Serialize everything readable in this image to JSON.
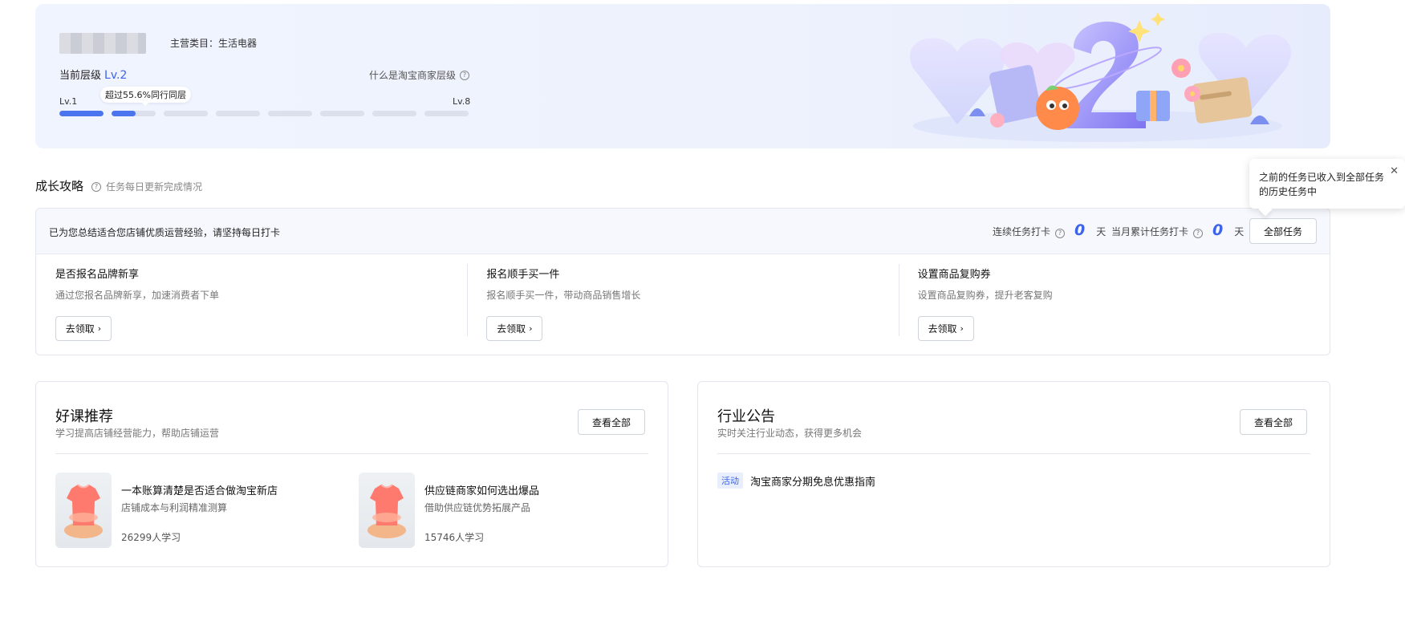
{
  "banner": {
    "main_category": "主营类目：生活电器",
    "level_label": "当前层级",
    "level_value": "Lv.2",
    "what_link": "什么是淘宝商家层级",
    "lv_min": "Lv.1",
    "lv_max": "Lv.8",
    "progress_tip": "超过55.6%同行同层",
    "levels_total": 8,
    "current_level": 2,
    "current_segment_fill": 0.55
  },
  "growth": {
    "title": "成长攻略",
    "subtitle": "任务每日更新完成情况",
    "hint": "已为您总结适合您店铺优质运营经验，请坚持每日打卡",
    "streak_label": "连续任务打卡",
    "streak_value": "0",
    "month_label": "当月累计任务打卡",
    "month_value": "0",
    "unit": "天",
    "all_tasks_btn": "全部任务",
    "tasks": [
      {
        "title": "是否报名品牌新享",
        "desc": "通过您报名品牌新享，加速消费者下单",
        "btn": "去领取"
      },
      {
        "title": "报名顺手买一件",
        "desc": "报名顺手买一件，带动商品销售增长",
        "btn": "去领取"
      },
      {
        "title": "设置商品复购券",
        "desc": "设置商品复购券，提升老客复购",
        "btn": "去领取"
      }
    ]
  },
  "popover": {
    "text": "之前的任务已收入到全部任务的历史任务中",
    "close": "✕"
  },
  "courses": {
    "title": "好课推荐",
    "subtitle": "学习提高店铺经营能力，帮助店铺运营",
    "view_all": "查看全部",
    "items": [
      {
        "title": "一本账算清楚是否适合做淘宝新店",
        "desc": "店铺成本与利润精准测算",
        "count": "26299人学习"
      },
      {
        "title": "供应链商家如何选出爆品",
        "desc": "借助供应链优势拓展产品",
        "count": "15746人学习"
      }
    ]
  },
  "notice": {
    "title": "行业公告",
    "subtitle": "实时关注行业动态，获得更多机会",
    "view_all": "查看全部",
    "items": [
      {
        "tag": "活动",
        "text": "淘宝商家分期免息优惠指南"
      }
    ]
  },
  "icons": {
    "help": "?",
    "chevron": "›"
  },
  "colors": {
    "accent": "#3d63ea",
    "progress": "#4b74ef"
  }
}
